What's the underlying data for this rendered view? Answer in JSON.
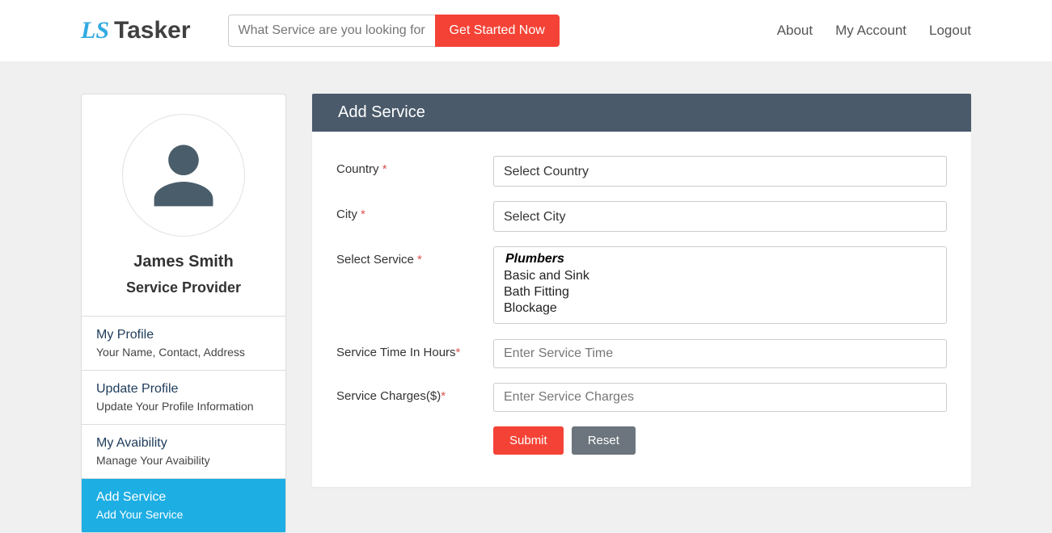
{
  "header": {
    "logo_prefix": "LS",
    "logo_text": "Tasker",
    "search_placeholder": "What Service are you looking for",
    "get_started": "Get Started Now",
    "nav": {
      "about": "About",
      "account": "My Account",
      "logout": "Logout"
    }
  },
  "sidebar": {
    "name": "James Smith",
    "role": "Service Provider",
    "items": [
      {
        "title": "My Profile",
        "sub": "Your Name, Contact, Address"
      },
      {
        "title": "Update Profile",
        "sub": "Update Your Profile Information"
      },
      {
        "title": "My Avaibility",
        "sub": "Manage Your Avaibility"
      },
      {
        "title": "Add Service",
        "sub": "Add Your Service"
      }
    ]
  },
  "panel": {
    "title": "Add Service",
    "labels": {
      "country": "Country ",
      "city": "City ",
      "service": "Select Service ",
      "time": "Service Time In Hours",
      "charges": "Service Charges($)"
    },
    "country_placeholder": "Select Country",
    "city_placeholder": "Select City",
    "services_group": "Plumbers",
    "services_options": [
      "Basic and Sink",
      "Bath Fitting",
      "Blockage"
    ],
    "time_placeholder": "Enter Service Time",
    "charges_placeholder": "Enter Service Charges",
    "submit": "Submit",
    "reset": "Reset"
  }
}
